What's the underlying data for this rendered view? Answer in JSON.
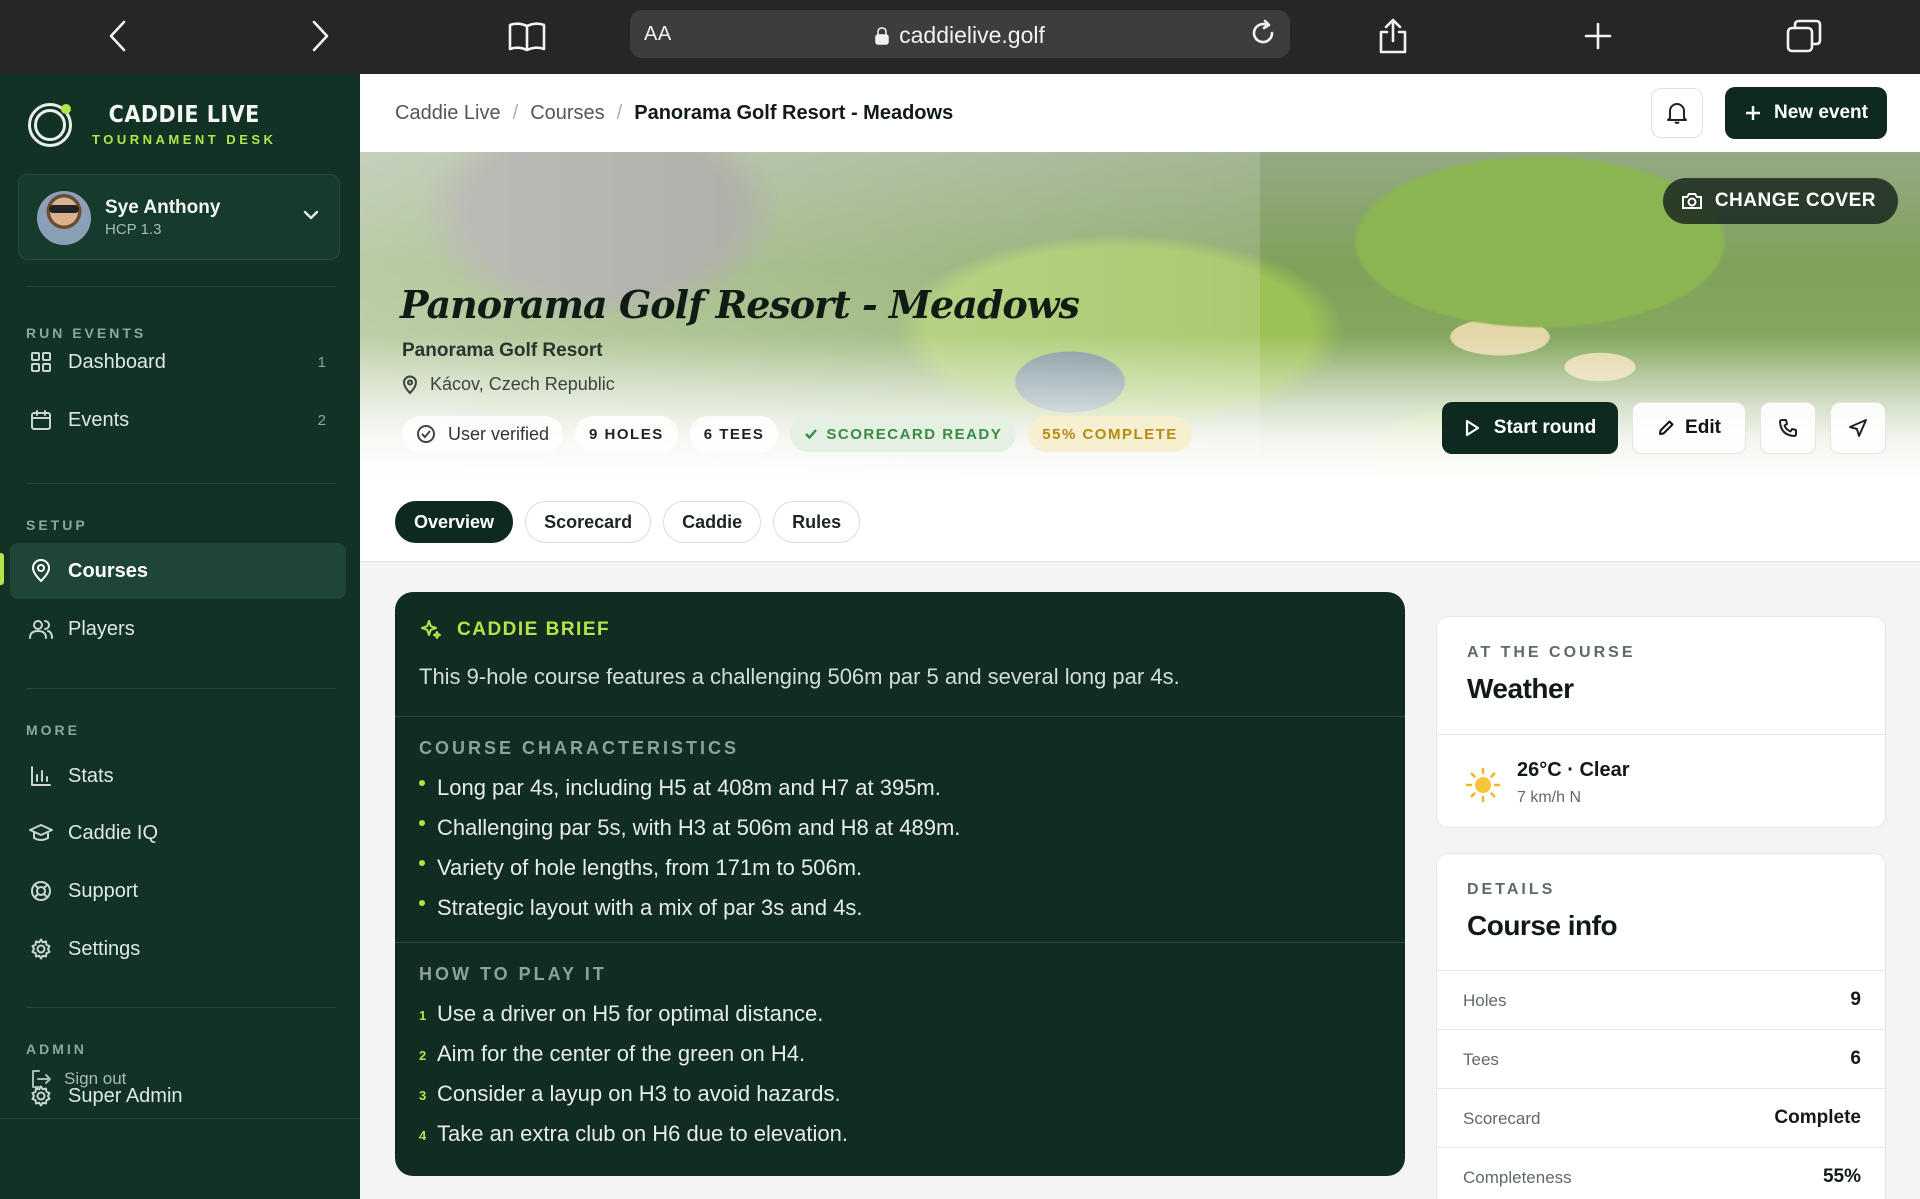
{
  "browser": {
    "aa_label": "AA",
    "url": "caddielive.golf"
  },
  "sidebar": {
    "brand_title": "CADDIE LIVE",
    "brand_subtitle": "TOURNAMENT DESK",
    "user": {
      "name": "Sye Anthony",
      "hcp": "HCP 1.3"
    },
    "sections": {
      "run_events": "RUN EVENTS",
      "setup": "SETUP",
      "more": "MORE",
      "admin": "ADMIN"
    },
    "items": {
      "dashboard": {
        "label": "Dashboard",
        "count": "1"
      },
      "events": {
        "label": "Events",
        "count": "2"
      },
      "courses": {
        "label": "Courses"
      },
      "players": {
        "label": "Players"
      },
      "stats": {
        "label": "Stats"
      },
      "caddie_iq": {
        "label": "Caddie IQ"
      },
      "support": {
        "label": "Support"
      },
      "settings": {
        "label": "Settings"
      },
      "super_admin": {
        "label": "Super Admin"
      }
    },
    "sign_out": "Sign out",
    "active_item": "courses",
    "accent_color": "#b6e34a"
  },
  "header": {
    "breadcrumb": [
      "Caddie Live",
      "Courses",
      "Panorama Golf Resort - Meadows"
    ],
    "new_event_label": "New event"
  },
  "hero": {
    "change_cover_label": "CHANGE COVER",
    "title": "Panorama Golf Resort - Meadows",
    "resort": "Panorama Golf Resort",
    "location": "Kácov, Czech Republic",
    "chips": {
      "verified": "User verified",
      "holes": "9 HOLES",
      "tees": "6 TEES",
      "scorecard": "SCORECARD READY",
      "complete": "55% COMPLETE"
    },
    "start_round_label": "Start round",
    "edit_label": "Edit"
  },
  "tabs": [
    "Overview",
    "Scorecard",
    "Caddie",
    "Rules"
  ],
  "active_tab": "Overview",
  "brief": {
    "heading": "CADDIE BRIEF",
    "summary": "This 9-hole course features a challenging 506m par 5 and several long par 4s.",
    "characteristics_heading": "COURSE CHARACTERISTICS",
    "characteristics": [
      "Long par 4s, including H5 at 408m and H7 at 395m.",
      "Challenging par 5s, with H3 at 506m and H8 at 489m.",
      "Variety of hole lengths, from 171m to 506m.",
      "Strategic layout with a mix of par 3s and 4s."
    ],
    "howto_heading": "HOW TO PLAY IT",
    "howto": [
      {
        "n": "1",
        "text": "Use a driver on H5 for optimal distance."
      },
      {
        "n": "2",
        "text": "Aim for the center of the green on H4."
      },
      {
        "n": "3",
        "text": "Consider a layup on H3 to avoid hazards."
      },
      {
        "n": "4",
        "text": "Take an extra club on H6 due to elevation."
      }
    ]
  },
  "weather": {
    "eyebrow": "AT THE COURSE",
    "title": "Weather",
    "condition": "26°C · Clear",
    "wind": "7 km/h N",
    "icon": "sun-icon"
  },
  "course_info": {
    "eyebrow": "DETAILS",
    "title": "Course info",
    "rows": [
      {
        "key": "Holes",
        "value": "9"
      },
      {
        "key": "Tees",
        "value": "6"
      },
      {
        "key": "Scorecard",
        "value": "Complete"
      },
      {
        "key": "Completeness",
        "value": "55%"
      }
    ]
  }
}
